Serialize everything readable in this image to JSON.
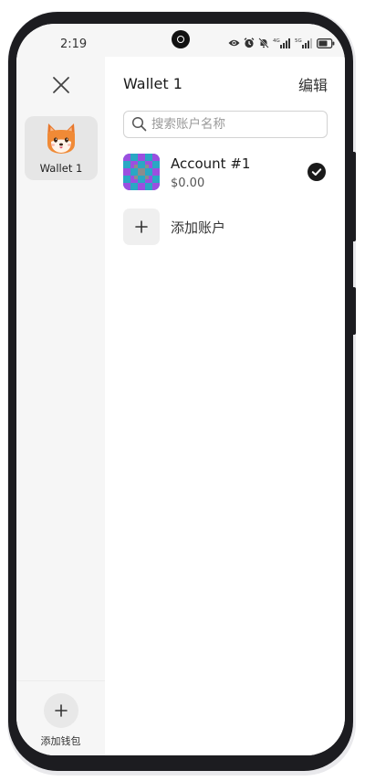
{
  "status_bar": {
    "time": "2:19",
    "icons": [
      "eye-icon",
      "alarm-icon",
      "bell-muted-icon",
      "signal-4g-icon",
      "signal-5g-icon",
      "battery-icon"
    ],
    "network_1": "4G",
    "network_2": "5G"
  },
  "rail": {
    "close_icon": "close-icon",
    "wallets": [
      {
        "name": "Wallet 1",
        "icon": "fox-icon",
        "selected": true
      }
    ],
    "add_wallet_label": "添加钱包"
  },
  "main": {
    "wallet_title": "Wallet 1",
    "edit_label": "编辑",
    "search": {
      "placeholder": "搜索账户名称",
      "value": ""
    },
    "accounts": [
      {
        "name": "Account #1",
        "balance": "$0.00",
        "selected": true
      }
    ],
    "add_account_label": "添加账户"
  },
  "colors": {
    "rail_background": "#f6f6f6",
    "selected_wallet_background": "#e6e6e6",
    "phone_frame": "#1c1c20",
    "check": "#1a1a1a",
    "avatar_purple": "#9b4fe0",
    "avatar_teal": "#2aa7c4"
  }
}
